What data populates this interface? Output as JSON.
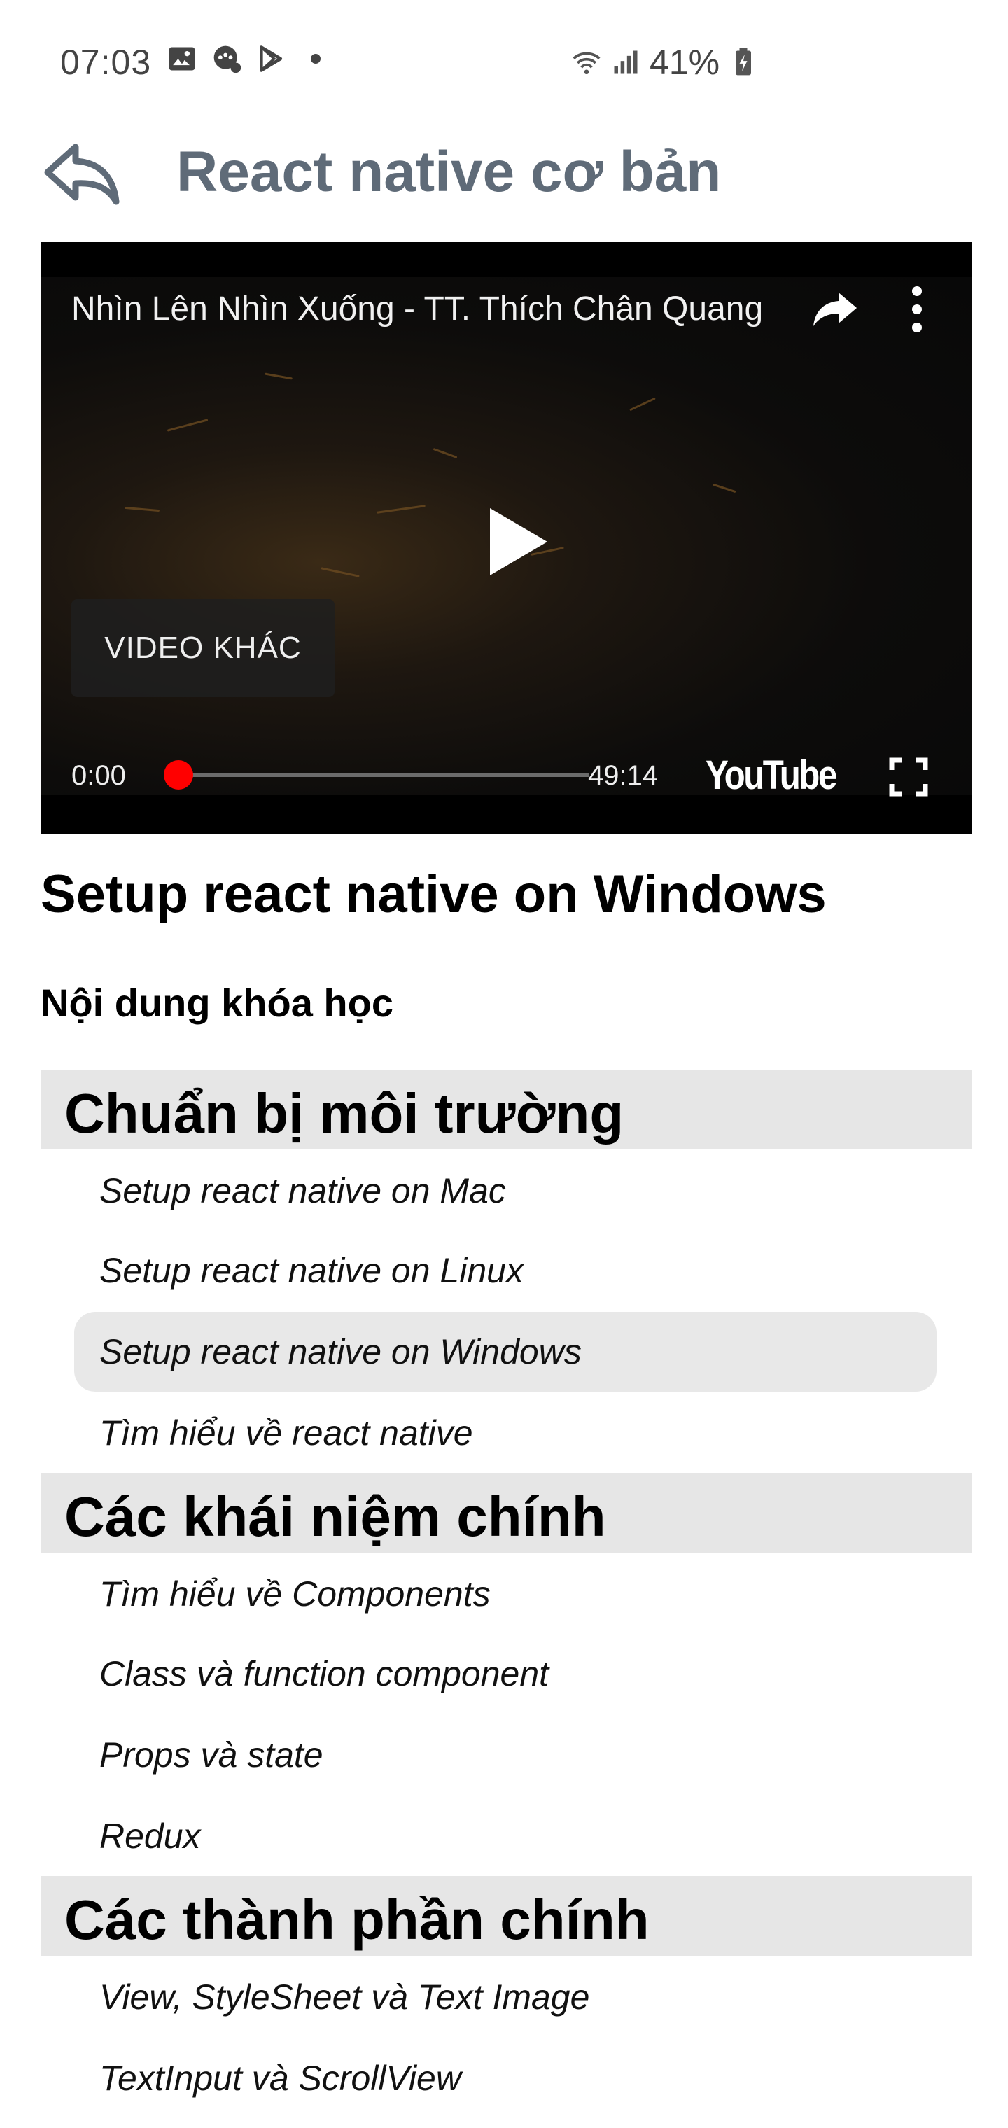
{
  "status_bar": {
    "time": "07:03",
    "battery": "41%",
    "icons": [
      "image-icon",
      "messenger-bubble-icon",
      "play-store-icon",
      "dot-icon",
      "wifi-icon",
      "signal-icon",
      "battery-charging-icon"
    ]
  },
  "header": {
    "title": "React native cơ bản",
    "back_icon": "back-arrow-icon"
  },
  "player": {
    "video_title": "Nhìn Lên Nhìn Xuống - TT. Thích Chân Quang",
    "other_videos_label": "VIDEO KHÁC",
    "current_time": "0:00",
    "duration": "49:14",
    "progress": 0,
    "logo_text": "YouTube",
    "colors": {
      "progress_accent": "#ff0000"
    }
  },
  "content": {
    "lesson_title": "Setup react native on Windows",
    "course_content_label": "Nội dung khóa học",
    "sections": [
      {
        "title": "Chuẩn bị môi trường",
        "lessons": [
          {
            "label": "Setup react native on Mac"
          },
          {
            "label": "Setup react native on Linux"
          },
          {
            "label": "Setup react native on Windows",
            "active": true
          },
          {
            "label": "Tìm hiểu về react native"
          }
        ]
      },
      {
        "title": "Các khái niệm chính",
        "lessons": [
          {
            "label": "Tìm hiểu về Components"
          },
          {
            "label": "Class và function component"
          },
          {
            "label": "Props và state"
          },
          {
            "label": "Redux"
          }
        ]
      },
      {
        "title": "Các thành phần chính",
        "lessons": [
          {
            "label": "View, StyleSheet và Text Image"
          },
          {
            "label": "TextInput và ScrollView"
          }
        ]
      }
    ]
  }
}
